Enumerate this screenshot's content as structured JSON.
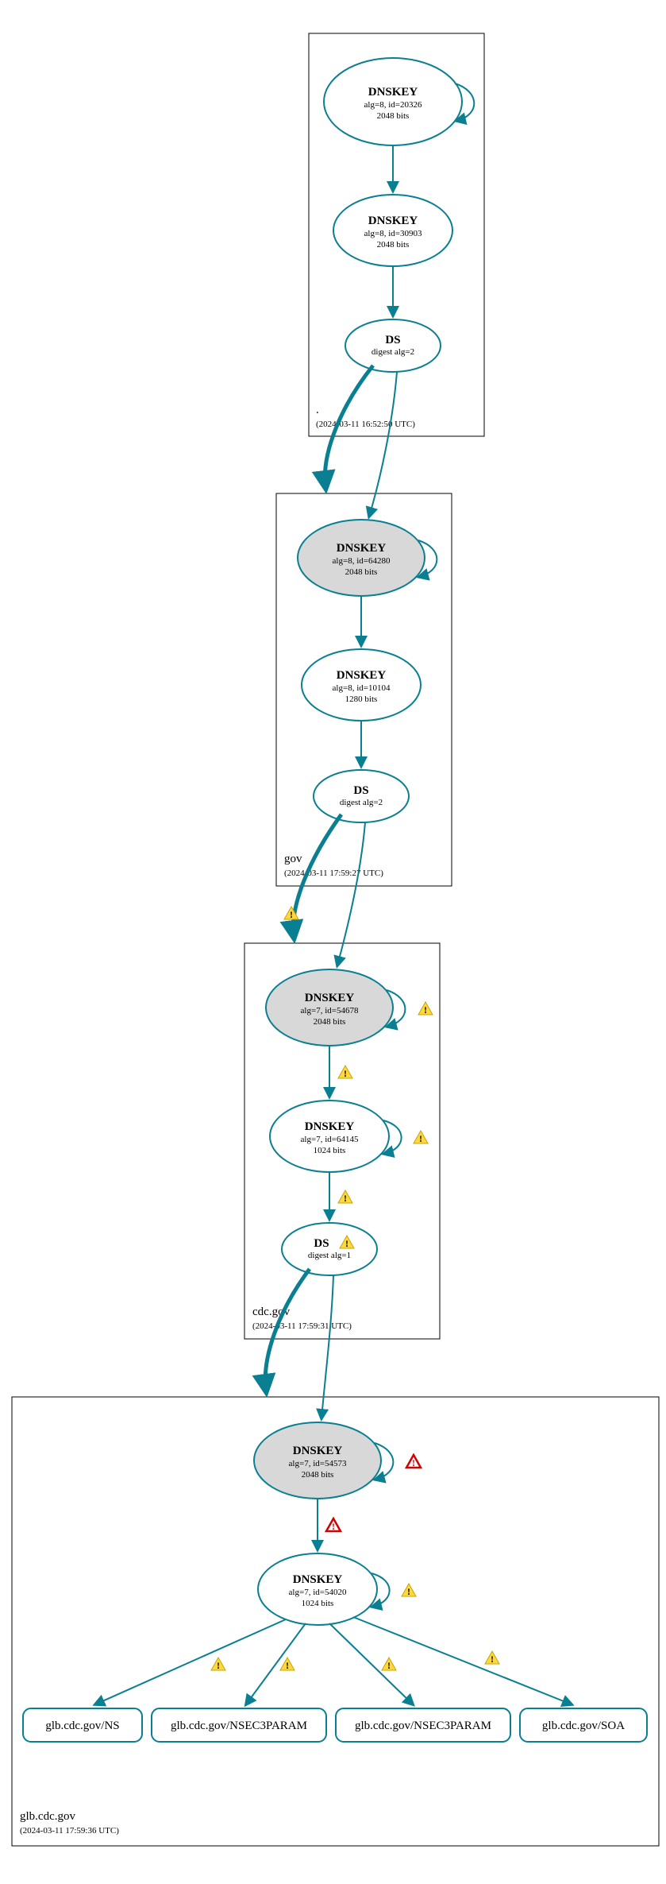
{
  "zones": [
    {
      "name": ".",
      "timestamp": "(2024-03-11 16:52:50 UTC)",
      "nodes": [
        {
          "id": "root-ksk",
          "title": "DNSKEY",
          "line1": "alg=8, id=20326",
          "line2": "2048 bits"
        },
        {
          "id": "root-zsk",
          "title": "DNSKEY",
          "line1": "alg=8, id=30903",
          "line2": "2048 bits"
        },
        {
          "id": "root-ds",
          "title": "DS",
          "line1": "digest alg=2"
        }
      ]
    },
    {
      "name": "gov",
      "timestamp": "(2024-03-11 17:59:27 UTC)",
      "nodes": [
        {
          "id": "gov-ksk",
          "title": "DNSKEY",
          "line1": "alg=8, id=64280",
          "line2": "2048 bits"
        },
        {
          "id": "gov-zsk",
          "title": "DNSKEY",
          "line1": "alg=8, id=10104",
          "line2": "1280 bits"
        },
        {
          "id": "gov-ds",
          "title": "DS",
          "line1": "digest alg=2"
        }
      ]
    },
    {
      "name": "cdc.gov",
      "timestamp": "(2024-03-11 17:59:31 UTC)",
      "nodes": [
        {
          "id": "cdc-ksk",
          "title": "DNSKEY",
          "line1": "alg=7, id=54678",
          "line2": "2048 bits"
        },
        {
          "id": "cdc-zsk",
          "title": "DNSKEY",
          "line1": "alg=7, id=64145",
          "line2": "1024 bits"
        },
        {
          "id": "cdc-ds",
          "title": "DS",
          "line1": "digest alg=1"
        }
      ]
    },
    {
      "name": "glb.cdc.gov",
      "timestamp": "(2024-03-11 17:59:36 UTC)",
      "nodes": [
        {
          "id": "glb-ksk",
          "title": "DNSKEY",
          "line1": "alg=7, id=54573",
          "line2": "2048 bits"
        },
        {
          "id": "glb-zsk",
          "title": "DNSKEY",
          "line1": "alg=7, id=54020",
          "line2": "1024 bits"
        }
      ],
      "leaves": [
        "glb.cdc.gov/NS",
        "glb.cdc.gov/NSEC3PARAM",
        "glb.cdc.gov/NSEC3PARAM",
        "glb.cdc.gov/SOA"
      ]
    }
  ]
}
